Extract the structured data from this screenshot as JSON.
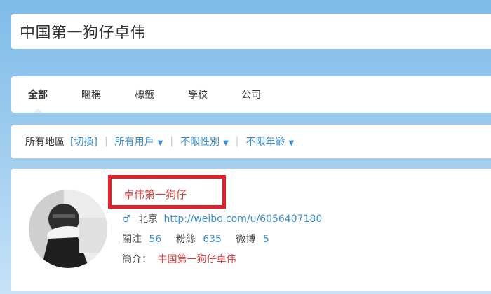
{
  "search": {
    "value": "中国第一狗仔卓伟"
  },
  "tabs": [
    {
      "label": "全部",
      "active": true
    },
    {
      "label": "暱稱",
      "active": false
    },
    {
      "label": "標籤",
      "active": false
    },
    {
      "label": "學校",
      "active": false
    },
    {
      "label": "公司",
      "active": false
    }
  ],
  "filters": {
    "region_label": "所有地區",
    "switch_link": "[切換]",
    "users": "所有用戶",
    "gender": "不限性別",
    "age": "不限年齡"
  },
  "result": {
    "name": "卓伟第一狗仔",
    "gender_icon": "male-icon",
    "location": "北京",
    "url": "http://weibo.com/u/6056407180",
    "stats": [
      {
        "label": "關注",
        "count": "56"
      },
      {
        "label": "粉絲",
        "count": "635"
      },
      {
        "label": "微博",
        "count": "5"
      }
    ],
    "intro_label": "簡介：",
    "intro": "中国第一狗仔卓伟"
  },
  "colors": {
    "link": "#3b8ed1",
    "highlight": "#d64141",
    "box": "#e4212b"
  }
}
